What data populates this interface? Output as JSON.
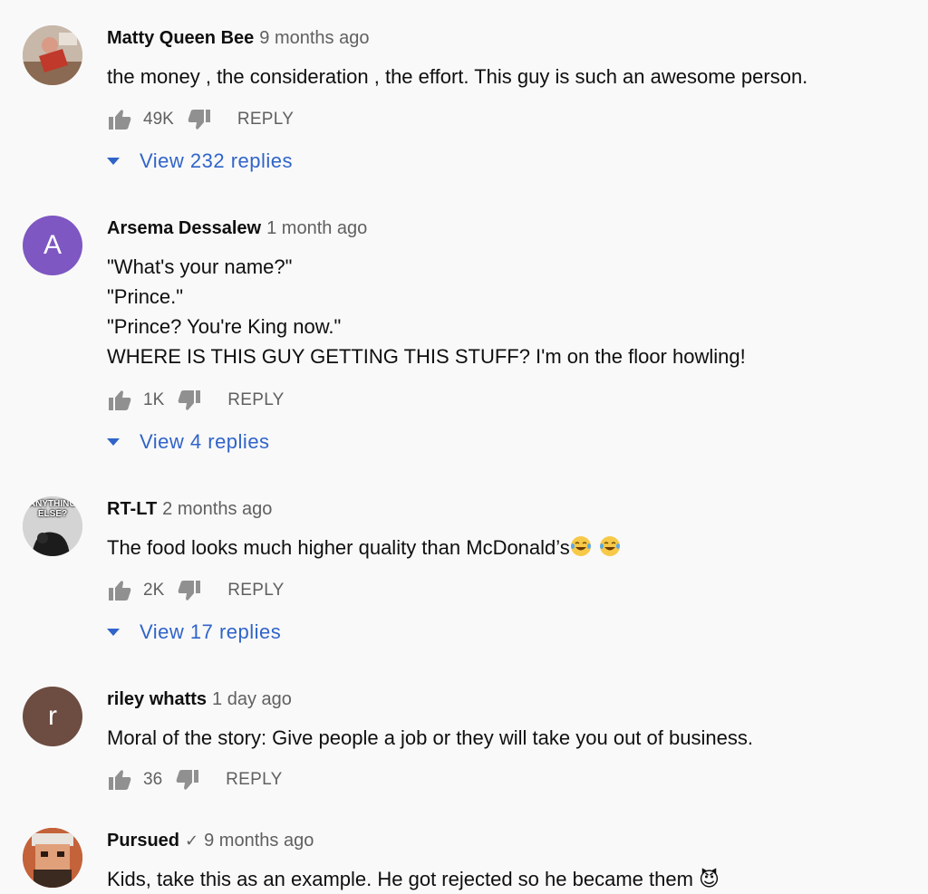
{
  "comments": [
    {
      "author": "Matty Queen Bee",
      "time": "9 months ago",
      "lines": "the money , the consideration , the effort. This guy is such an awesome person.",
      "likes": "49K",
      "reply_label": "REPLY",
      "view_replies": "View 232 replies",
      "avatar": "photo"
    },
    {
      "author": "Arsema Dessalew",
      "time": "1 month ago",
      "lines": "\"What's your name?\"\n\"Prince.\"\n\"Prince? You're King now.\"\nWHERE IS THIS GUY GETTING THIS STUFF? I'm on the floor howling!",
      "likes": "1K",
      "reply_label": "REPLY",
      "view_replies": "View 4 replies",
      "avatar_letter": "A",
      "avatar_color": "#7e57c2"
    },
    {
      "author": "RT-LT",
      "time": "2 months ago",
      "lines": "The food looks much higher quality than McDonald’s",
      "likes": "2K",
      "reply_label": "REPLY",
      "view_replies": "View 17 replies",
      "avatar_text": "ANYTHING ELSE?",
      "emoji": "laughing-tears-emoji"
    },
    {
      "author": "riley whatts",
      "time": "1 day ago",
      "lines": "Moral of the story: Give people a job or they will take you out of business.",
      "likes": "36",
      "reply_label": "REPLY",
      "avatar_letter": "r",
      "avatar_color": "#6d4c41"
    },
    {
      "author": "Pursued",
      "verified": "✓",
      "time": "9 months ago",
      "lines": "Kids, take this as an example. He got rejected so he became them 😈",
      "avatar": "cartoon"
    }
  ],
  "colors": {
    "background": "#f9f9f9",
    "link": "#3064c9",
    "secondary_text": "#606060"
  },
  "icons": [
    "thumb-up-icon",
    "thumb-down-icon",
    "caret-down-icon"
  ]
}
